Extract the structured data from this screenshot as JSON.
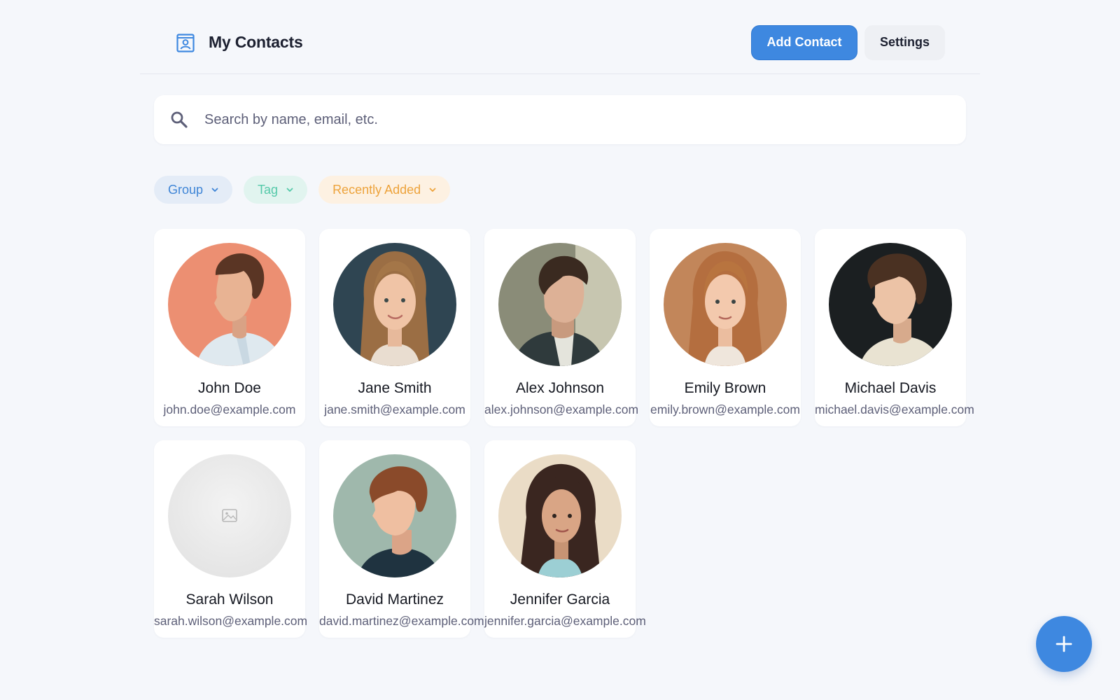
{
  "header": {
    "title": "My Contacts",
    "brand_icon": "contact-card-icon",
    "add_contact_label": "Add Contact",
    "settings_label": "Settings"
  },
  "search": {
    "placeholder": "Search by name, email, etc.",
    "value": ""
  },
  "filters": [
    {
      "label": "Group",
      "icon": "chevron-down-icon",
      "color": "#3f85d6"
    },
    {
      "label": "Tag",
      "icon": "chevron-down-icon",
      "color": "#55c9a9"
    },
    {
      "label": "Recently Added",
      "icon": "chevron-down-icon",
      "color": "#eda33c"
    }
  ],
  "contacts": [
    {
      "name": "John Doe",
      "email": "john.doe@example.com",
      "avatar": "man-profile-portrait"
    },
    {
      "name": "Jane Smith",
      "email": "jane.smith@example.com",
      "avatar": "woman-front-portrait"
    },
    {
      "name": "Alex Johnson",
      "email": "alex.johnson@example.com",
      "avatar": "man-side-portrait"
    },
    {
      "name": "Emily Brown",
      "email": "emily.brown@example.com",
      "avatar": "woman-front-portrait"
    },
    {
      "name": "Michael Davis",
      "email": "michael.davis@example.com",
      "avatar": "man-side-portrait"
    },
    {
      "name": "Sarah Wilson",
      "email": "sarah.wilson@example.com",
      "avatar": "image-placeholder"
    },
    {
      "name": "David Martinez",
      "email": "david.martinez@example.com",
      "avatar": "man-side-portrait"
    },
    {
      "name": "Jennifer Garcia",
      "email": "jennifer.garcia@example.com",
      "avatar": "woman-side-portrait"
    }
  ],
  "fab": {
    "icon": "plus-icon"
  },
  "colors": {
    "accent": "#3e88e0",
    "background": "#f5f7fb",
    "muted_text": "#5d5f78"
  }
}
